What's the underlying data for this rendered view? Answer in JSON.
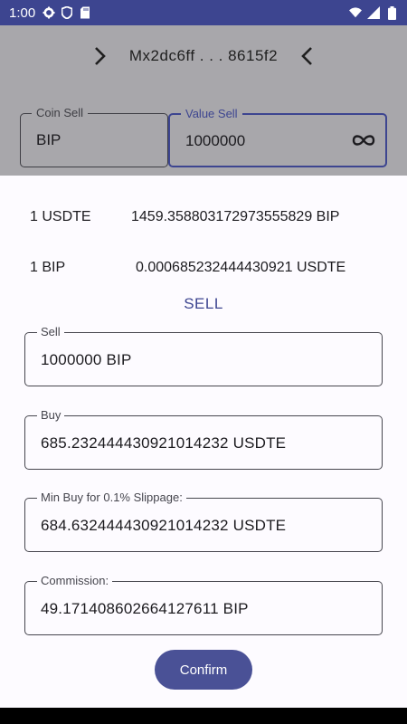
{
  "status_bar": {
    "time": "1:00",
    "icons": [
      "gear-icon",
      "shield-icon",
      "sdcard-icon",
      "wifi-icon",
      "signal-icon",
      "battery-icon"
    ]
  },
  "background": {
    "header": {
      "address": "Mx2dc6ff . . . 8615f2",
      "left_icon": "chevron-right-icon",
      "right_icon": "chevron-left-icon"
    },
    "coin_sell": {
      "label": "Coin Sell",
      "value": "BIP"
    },
    "value_sell": {
      "label": "Value Sell",
      "value": "1000000",
      "trailing_icon": "infinity-icon"
    }
  },
  "sheet": {
    "rates": [
      {
        "unit": "1 USDTE",
        "value": "1459.358803172973555829 BIP"
      },
      {
        "unit": "1 BIP",
        "value": "0.000685232444430921 USDTE"
      }
    ],
    "action_label": "SELL",
    "fields": [
      {
        "label": "Sell",
        "value": "1000000 BIP"
      },
      {
        "label": "Buy",
        "value": "685.232444430921014232 USDTE"
      },
      {
        "label": "Min Buy for 0.1% Slippage:",
        "value": "684.632444430921014232 USDTE"
      },
      {
        "label": "Commission:",
        "value": "49.171408602664127611 BIP"
      }
    ],
    "confirm_label": "Confirm"
  },
  "colors": {
    "accent": "#3d4590",
    "button": "#4a5196",
    "scrim": "#a8a7ab",
    "surface": "#fdfbff"
  }
}
